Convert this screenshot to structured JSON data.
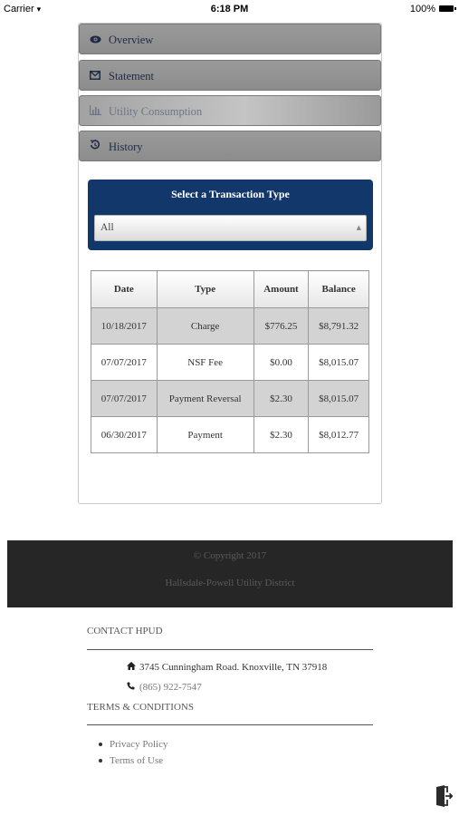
{
  "status_bar": {
    "carrier": "Carrier",
    "time": "6:18 PM",
    "battery": "100%"
  },
  "tabs": [
    {
      "label": "Overview",
      "icon": "eye-icon"
    },
    {
      "label": "Statement",
      "icon": "envelope-icon"
    },
    {
      "label": "Utility Consumption",
      "icon": "bar-chart-icon"
    },
    {
      "label": "History",
      "icon": "history-icon"
    }
  ],
  "transaction_type": {
    "label": "Select a Transaction Type",
    "selected": "All"
  },
  "table": {
    "headers": [
      "Date",
      "Type",
      "Amount",
      "Balance"
    ],
    "rows": [
      [
        "10/18/2017",
        "Charge",
        "$776.25",
        "$8,791.32"
      ],
      [
        "07/07/2017",
        "NSF Fee",
        "$0.00",
        "$8,015.07"
      ],
      [
        "07/07/2017",
        "Payment Reversal",
        "$2.30",
        "$8,015.07"
      ],
      [
        "06/30/2017",
        "Payment",
        "$2.30",
        "$8,012.77"
      ]
    ]
  },
  "footer": {
    "copyright": "© Copyright 2017",
    "district": "Hallsdale-Powell Utility District"
  },
  "contact": {
    "title": "CONTACT HPUD",
    "address": "3745 Cunningham Road. Knoxville, TN 37918",
    "phone": "(865) 922-7547"
  },
  "terms": {
    "title": "TERMS & CONDITIONS",
    "links": [
      "Privacy Policy",
      "Terms of Use"
    ]
  },
  "colors": {
    "tab_bg": "#8f8f8f",
    "transaction_box": "#12386b",
    "footer_bg": "#262626",
    "alt_row": "#d3d3d3"
  }
}
